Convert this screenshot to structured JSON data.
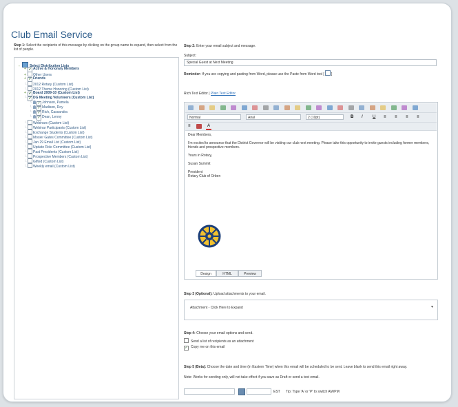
{
  "page": {
    "title": "Club Email Service"
  },
  "step1": {
    "label": "Step 1:",
    "text": "Select the recipients of this message by clicking on the group name to expand, then select from the list of people."
  },
  "tree": {
    "root": "Select Distribution Lists",
    "items": [
      {
        "label": "Active & Honorary Members",
        "bold": true,
        "twisty": "+",
        "check": "✓",
        "indent": 1
      },
      {
        "label": "Other Users",
        "bold": false,
        "twisty": "+",
        "check": "",
        "indent": 1
      },
      {
        "label": "Friends",
        "bold": true,
        "twisty": "+",
        "check": "✓",
        "indent": 1
      },
      {
        "label": "2012 Rotary (Custom List)",
        "bold": false,
        "twisty": "-",
        "check": "",
        "indent": 1
      },
      {
        "label": "2012 Theme Honoring (Custom List)",
        "bold": false,
        "twisty": "-",
        "check": "",
        "indent": 1
      },
      {
        "label": "Board 2009-10 (Custom List)",
        "bold": true,
        "twisty": "+",
        "check": "✓",
        "indent": 1
      },
      {
        "label": "DG Meeting Volunteers (Custom List)",
        "bold": true,
        "twisty": "-",
        "check": "✓",
        "indent": 1
      },
      {
        "label": "Johnson, Pamela",
        "bold": false,
        "twisty": "",
        "check": "✓",
        "indent": 2,
        "person": true
      },
      {
        "label": "Madison, Roy",
        "bold": false,
        "twisty": "",
        "check": "✓",
        "indent": 2,
        "person": true
      },
      {
        "label": "Rich, Cassandra",
        "bold": false,
        "twisty": "",
        "check": "✓",
        "indent": 2,
        "person": true
      },
      {
        "label": "Dean, Lenny",
        "bold": false,
        "twisty": "",
        "check": "✓",
        "indent": 2,
        "person": true
      },
      {
        "label": "Webinars (Custom List)",
        "bold": false,
        "twisty": "-",
        "check": "",
        "indent": 1
      },
      {
        "label": "Webinar Participants (Custom List)",
        "bold": false,
        "twisty": "-",
        "check": "",
        "indent": 1
      },
      {
        "label": "Exchange Students (Custom List)",
        "bold": false,
        "twisty": "-",
        "check": "",
        "indent": 1
      },
      {
        "label": "Mosier Gates Committee (Custom List)",
        "bold": false,
        "twisty": "-",
        "check": "",
        "indent": 1
      },
      {
        "label": "Jan 29 Email List (Custom List)",
        "bold": false,
        "twisty": "-",
        "check": "",
        "indent": 1
      },
      {
        "label": "Update Role Committee (Custom List)",
        "bold": false,
        "twisty": "-",
        "check": "",
        "indent": 1
      },
      {
        "label": "Past Presidents (Custom List)",
        "bold": false,
        "twisty": "-",
        "check": "",
        "indent": 1
      },
      {
        "label": "Prospective Members (Custom List)",
        "bold": false,
        "twisty": "-",
        "check": "",
        "indent": 1
      },
      {
        "label": "Gifted (Custom List)",
        "bold": false,
        "twisty": "-",
        "check": "",
        "indent": 1
      },
      {
        "label": "Weekly email (Custom List)",
        "bold": false,
        "twisty": "-",
        "check": "",
        "indent": 1
      }
    ]
  },
  "step2": {
    "label": "Step 2:",
    "text": "Enter your email subject and message.",
    "subject_label": "Subject:",
    "subject_value": "Special Guest at Next Meeting",
    "paste_note": "If you are copying and pasting from Word, please use the Paste from Word tool [",
    "paste_icon": "clipboard-icon"
  },
  "editor": {
    "mode_prefix": "Rich Text Editor",
    "mode_link": "Plain Text Editor",
    "format_value": "Normal",
    "font_value": "Arial",
    "size_value": "2 (10pt)",
    "content": [
      "Dear Members,",
      "I'm excited to announce that the District Governor will be visiting our club next meeting. Please take this opportunity to invite guests including former members, friends and prospective members.",
      "Yours in Rotary,",
      "Susan Summit",
      "President",
      "Rotary Club of Orben"
    ],
    "tabs": [
      "Design",
      "HTML",
      "Preview"
    ],
    "toolbar_colors": [
      "#4d7fb8",
      "#c46a2a",
      "#e0b030",
      "#2f8a3d",
      "#9d3bb2",
      "#2a6fb8",
      "#d14a4a",
      "#6b6b6b"
    ]
  },
  "step3": {
    "label": "Step 3 (Optional):",
    "text": "Upload attachments to your email.",
    "attach_text": "Attachment - Click Here to Expand"
  },
  "step4": {
    "label": "Step 4:",
    "text": "Choose your email options and send.",
    "option1": "Send a list of recipients as an attachment",
    "option2": "Copy me on this email"
  },
  "step5": {
    "label": "Step 5 (Beta):",
    "text": "Choose the date and time (in Eastern Time) when this email will be scheduled to be sent. Leave blank to send this email right away.",
    "note": "Note: Works for sending only, will not take effect if you save as Draft or send a test email.",
    "tz": "EST",
    "tip": "Tip: Type 'A' or 'P' to switch AM/PM"
  },
  "colors": {
    "title": "#2b5b8a",
    "accent": "#2a6fb8"
  }
}
